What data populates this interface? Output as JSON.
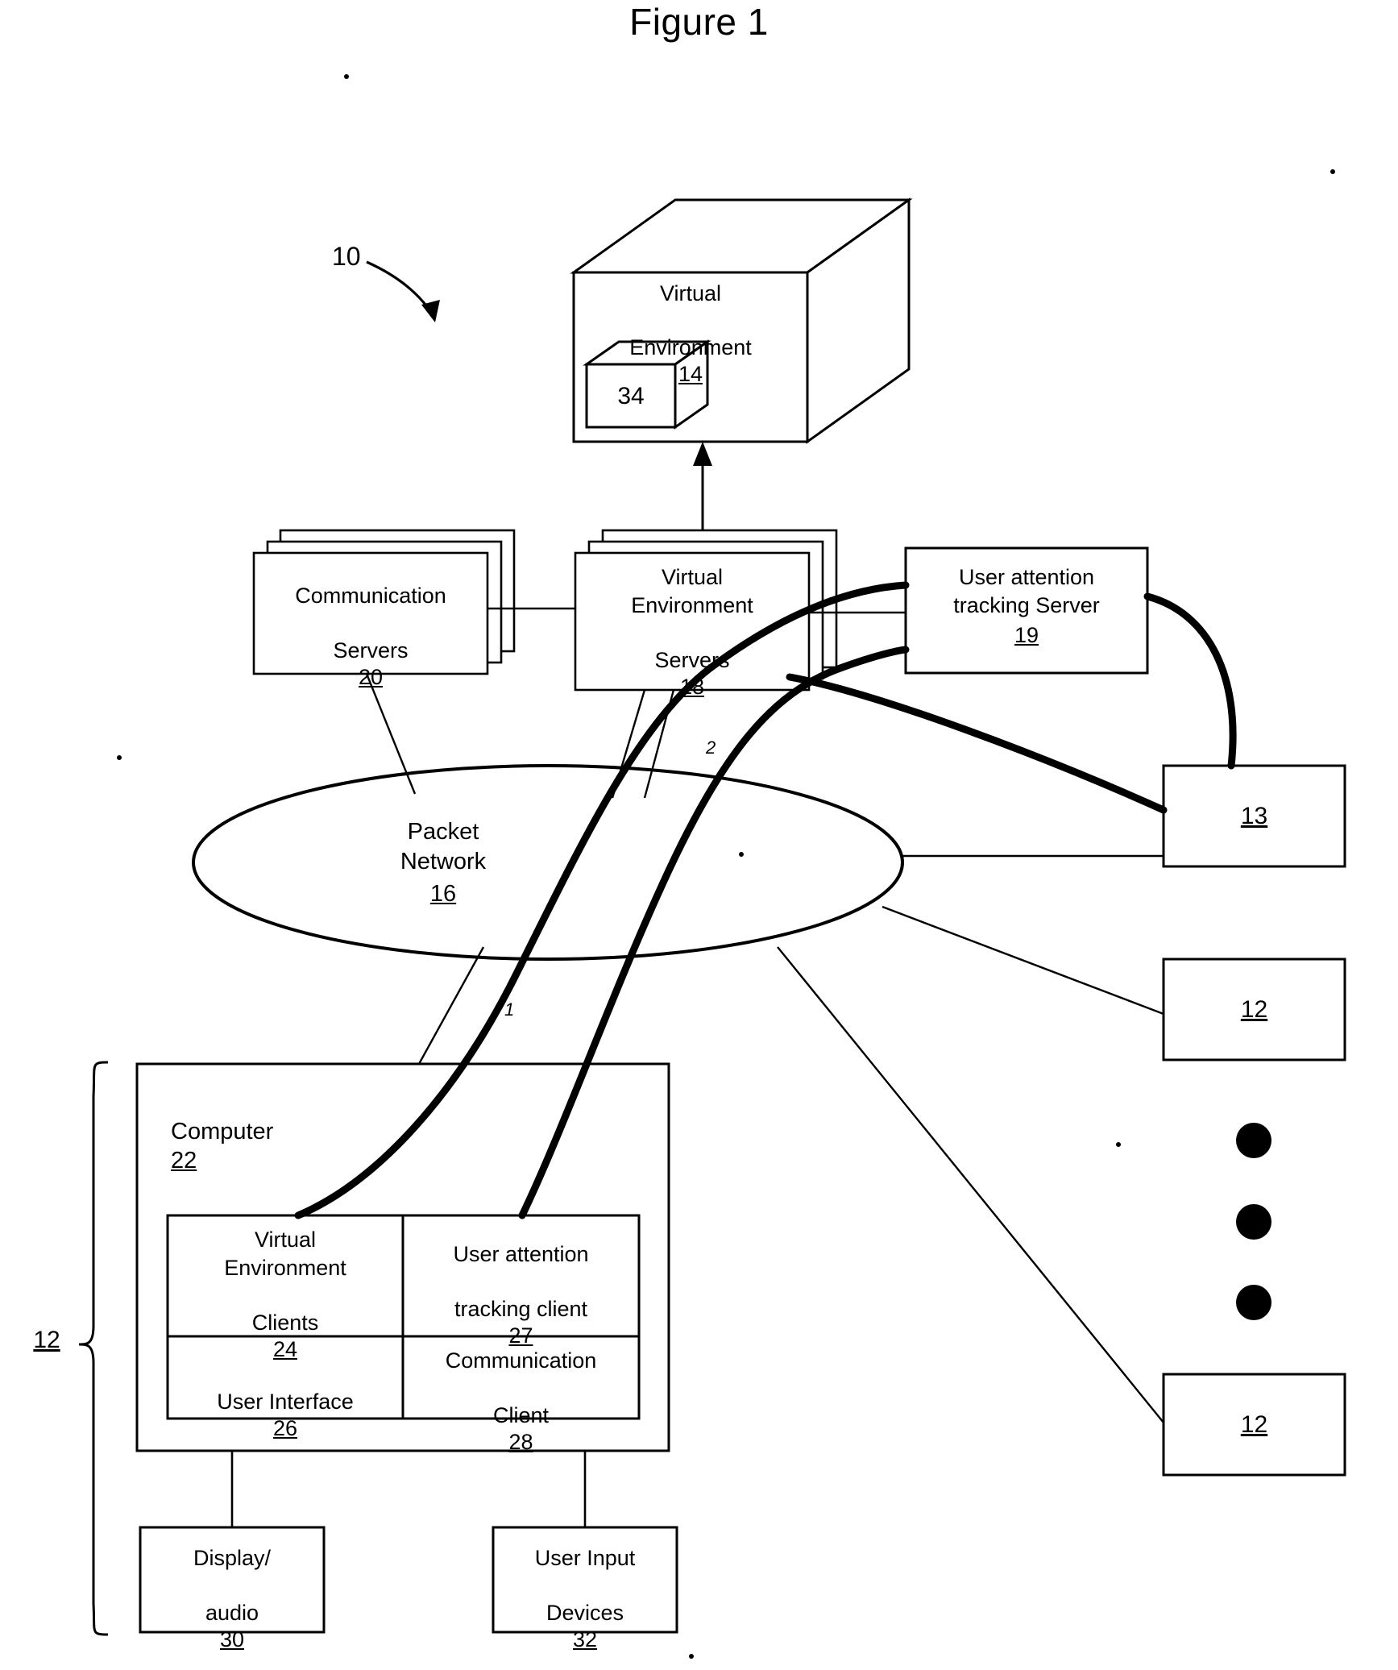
{
  "figure": {
    "title": "Figure 1",
    "system_ref": "10"
  },
  "virtual_environment_box": {
    "line1": "Virtual",
    "line2": "Environment",
    "ref": "14",
    "inner_cube_ref": "34"
  },
  "servers": {
    "communication": {
      "line1": "Communication",
      "line2": "Servers",
      "ref": "20"
    },
    "virtual_environment": {
      "line1": "Virtual",
      "line2": "Environment",
      "line3": "Servers",
      "ref": "18"
    },
    "user_attention_tracking": {
      "line1": "User attention",
      "line2": "tracking Server",
      "ref": "19"
    }
  },
  "network": {
    "line1": "Packet",
    "line2": "Network",
    "ref": "16"
  },
  "flow_labels": {
    "path_one": "1",
    "path_two": "2"
  },
  "terminals": [
    {
      "ref": "13"
    },
    {
      "ref": "12"
    },
    {
      "ref": "12"
    }
  ],
  "ellipsis_dots": 3,
  "client_system": {
    "group_ref": "12",
    "computer": {
      "label": "Computer",
      "ref": "22"
    },
    "modules": [
      {
        "line1": "Virtual",
        "line2": "Environment",
        "line3": "Clients",
        "ref": "24"
      },
      {
        "line1": "User attention",
        "line2": "tracking client",
        "ref": "27"
      },
      {
        "line1": "User Interface",
        "ref": "26"
      },
      {
        "line1": "Communication",
        "line2": "Client",
        "ref": "28"
      }
    ],
    "peripherals": [
      {
        "line1": "Display/",
        "line2": "audio",
        "ref": "30"
      },
      {
        "line1": "User Input",
        "line2": "Devices",
        "ref": "32"
      }
    ]
  },
  "colors": {
    "ink": "#000000",
    "paper": "#ffffff"
  }
}
